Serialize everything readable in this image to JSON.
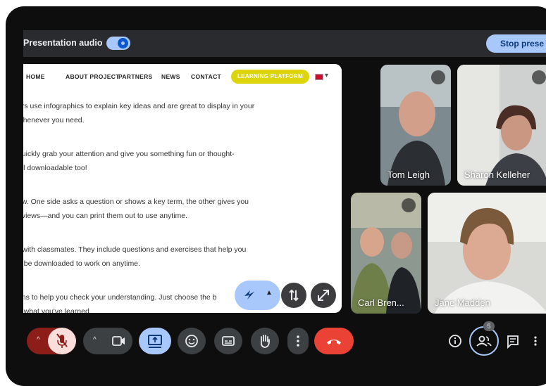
{
  "presentation_bar": {
    "audio_label": "Presentation audio",
    "stop_label": "Stop prese"
  },
  "website": {
    "nav": [
      "HOME",
      "ABOUT PROJECT",
      "PARTNERS",
      "NEWS",
      "CONTACT"
    ],
    "cta": "LEARNING PLATFORM",
    "lines": [
      "ers use infographics to explain key ideas and are great to display in your",
      "whenever you need.",
      "quickly grab your attention and give you something fun or thought-",
      "all downloadable too!",
      "ow. One side asks a question or shows a key term, the other gives you",
      "eviews—and you can print them out to use anytime.",
      "r with classmates. They include questions and exercises that help you",
      "o be downloaded to work on anytime.",
      "ons to help you check your understanding. Just choose the b",
      "n what you've learned."
    ]
  },
  "participants": [
    {
      "name": "Tom Leigh"
    },
    {
      "name": "Sharon Kelleher"
    },
    {
      "name": "Carl Bren..."
    },
    {
      "name": "Jane Madden"
    }
  ],
  "controls": {
    "people_count": "5"
  },
  "colors": {
    "accent_blue": "#a8c7fa",
    "end_call_red": "#ea4335",
    "mic_off_red": "#8c1d18",
    "cta_yellow": "#dcd50c"
  }
}
